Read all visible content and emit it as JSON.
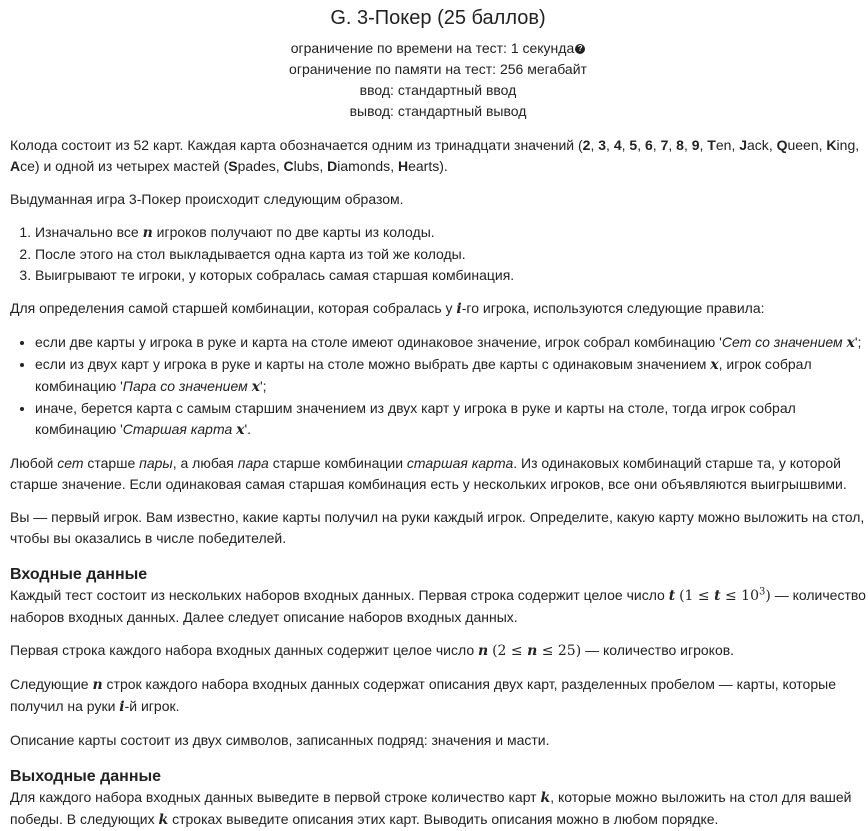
{
  "problem": {
    "title": "G. 3-Покер (25 баллов)",
    "time_limit": "ограничение по времени на тест: 1 секунда",
    "memory_limit": "ограничение по памяти на тест: 256 мегабайт",
    "input": "ввод: стандартный ввод",
    "output": "вывод: стандартный вывод"
  },
  "statement": {
    "p1_a": "Колода состоит из 52 карт. Каждая карта обозначается одним из тринадцати значений (",
    "values": [
      "2",
      "3",
      "4",
      "5",
      "6",
      "7",
      "8",
      "9"
    ],
    "ten_b": "T",
    "ten_r": "en",
    "jack_b": "J",
    "jack_r": "ack",
    "queen_b": "Q",
    "queen_r": "ueen",
    "king_b": "K",
    "king_r": "ing",
    "ace_b": "A",
    "ace_r": "ce",
    "p1_b": ") и одной из четырех мастей (",
    "spades_b": "S",
    "spades_r": "pades",
    "clubs_b": "C",
    "clubs_r": "lubs",
    "diamonds_b": "D",
    "diamonds_r": "iamonds",
    "hearts_b": "H",
    "hearts_r": "earts",
    "p1_c": ").",
    "p2": "Выдуманная игра 3-Покер происходит следующим образом.",
    "steps": [
      {
        "a": "Изначально все ",
        "var": "n",
        "b": " игроков получают по две карты из колоды."
      },
      {
        "a": "После этого на стол выкладывается одна карта из той же колоды.",
        "var": "",
        "b": ""
      },
      {
        "a": "Выигрывают те игроки, у которых собралась самая старшая комбинация.",
        "var": "",
        "b": ""
      }
    ],
    "p3_a": "Для определения самой старшей комбинации, которая собралась у ",
    "p3_var": "i",
    "p3_b": "-го игрока, используются следующие правила:",
    "rules": [
      {
        "a": "если две карты у игрока в руке и карта на столе имеют одинаковое значение, игрок собрал комбинацию '",
        "em": "Сет со значением ",
        "var": "x",
        "b": "';"
      },
      {
        "a": "если из двух карт у игрока в руке и карты на столе можно выбрать две карты с одинаковым значением ",
        "var0": "x",
        "a2": ", игрок собрал комбинацию '",
        "em": "Пара со значением ",
        "var": "x",
        "b": "';"
      },
      {
        "a": "иначе, берется карта с самым старшим значением из двух карт у игрока в руке и карты на столе, тогда игрок собрал комбинацию '",
        "em": "Старшая карта ",
        "var": "x",
        "b": "'."
      }
    ],
    "p4_a": "Любой ",
    "p4_em1": "сет",
    "p4_b": " старше ",
    "p4_em2": "пары",
    "p4_c": ", а любая ",
    "p4_em3": "пара",
    "p4_d": " старше комбинации ",
    "p4_em4": "старшая карта",
    "p4_e": ". Из одинаковых комбинаций старше та, у которой старше значение. Если одинаковая самая старшая комбинация есть у нескольких игроков, все они объявляются выигрышвими.",
    "p5": "Вы — первый игрок. Вам известно, какие карты получил на руки каждый игрок. Определите, какую карту можно выложить на стол, чтобы вы оказались в числе победителей."
  },
  "input_section": {
    "heading": "Входные данные",
    "p1_a": "Каждый тест состоит из нескольких наборов входных данных. Первая строка содержит целое число ",
    "p1_var": "t",
    "p1_math_a": "(1 ≤ ",
    "p1_math_var": "t",
    "p1_math_b": " ≤ 10",
    "p1_math_sup": "3",
    "p1_math_c": ")",
    "p1_b": " — количество наборов входных данных. Далее следует описание наборов входных данных.",
    "p2_a": "Первая строка каждого набора входных данных содержит целое число ",
    "p2_var": "n",
    "p2_math_a": "(2 ≤ ",
    "p2_math_var": "n",
    "p2_math_b": " ≤ 25)",
    "p2_b": " — количество игроков.",
    "p3_a": "Следующие ",
    "p3_var": "n",
    "p3_b": " строк каждого набора входных данных содержат описания двух карт, разделенных пробелом — карты, которые получил на руки ",
    "p3_var2": "i",
    "p3_c": "-й игрок.",
    "p4": "Описание карты состоит из двух символов, записанных подряд: значения и масти."
  },
  "output_section": {
    "heading": "Выходные данные",
    "p1_a": "Для каждого набора входных данных выведите в первой строке количество карт ",
    "p1_var": "k",
    "p1_b": ", которые можно выложить на стол для вашей победы. В следующих ",
    "p1_var2": "k",
    "p1_c": " строках выведите описания этих карт. Выводить описания можно в любом порядке."
  }
}
